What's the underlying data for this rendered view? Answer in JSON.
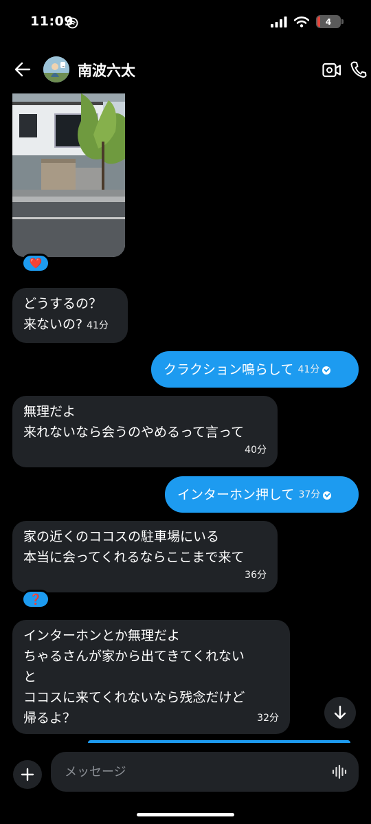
{
  "status_bar": {
    "time": "11:09",
    "battery": "4"
  },
  "header": {
    "name": "南波六太"
  },
  "reactions": {
    "heart": "❤️",
    "question": "❓"
  },
  "messages": [
    {
      "lines": [
        "どうするの？",
        "来ないの?"
      ],
      "time": "41分"
    },
    {
      "text": "クラクション鳴らして",
      "time": "41分"
    },
    {
      "lines": [
        "無理だよ",
        "来れないなら会うのやめるって言って"
      ],
      "time": "40分"
    },
    {
      "text": "インターホン押して",
      "time": "37分"
    },
    {
      "lines": [
        "家の近くのココスの駐車場にいる",
        "本当に会ってくれるならここまで来て"
      ],
      "time": "36分"
    },
    {
      "lines": [
        "インターホンとか無理だよ",
        "ちゃるさんが家から出てきてくれない",
        "と",
        "ココスに来てくれないなら残念だけど",
        "帰るよ？"
      ],
      "time": "32分"
    }
  ],
  "composer": {
    "placeholder": "メッセージ"
  }
}
